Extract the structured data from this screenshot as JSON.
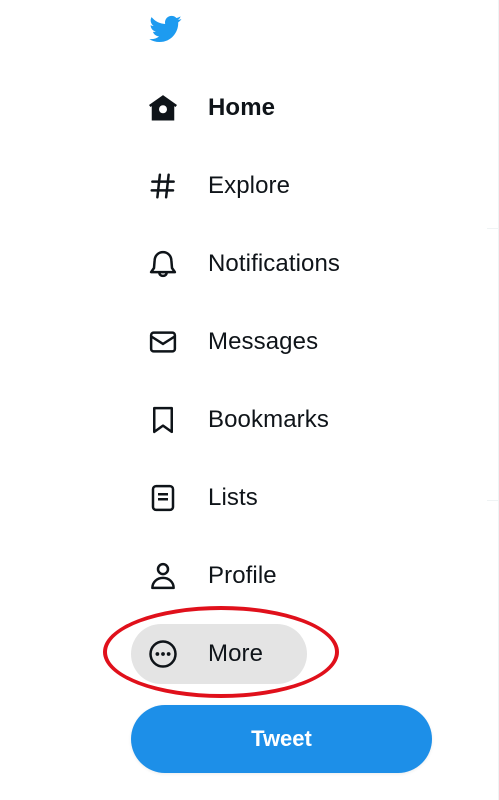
{
  "brand": {
    "logo_icon": "twitter-bird-icon",
    "color": "#1d9bf0"
  },
  "nav": {
    "items": [
      {
        "label": "Home",
        "icon": "home-icon",
        "active": true
      },
      {
        "label": "Explore",
        "icon": "hashtag-icon"
      },
      {
        "label": "Notifications",
        "icon": "bell-icon"
      },
      {
        "label": "Messages",
        "icon": "envelope-icon"
      },
      {
        "label": "Bookmarks",
        "icon": "bookmark-icon"
      },
      {
        "label": "Lists",
        "icon": "list-icon"
      },
      {
        "label": "Profile",
        "icon": "person-icon"
      },
      {
        "label": "More",
        "icon": "more-circle-icon",
        "hovered": true
      }
    ]
  },
  "tweet_button": {
    "label": "Tweet",
    "color": "#1d8fe8"
  },
  "annotation": {
    "color": "#e0101b"
  }
}
